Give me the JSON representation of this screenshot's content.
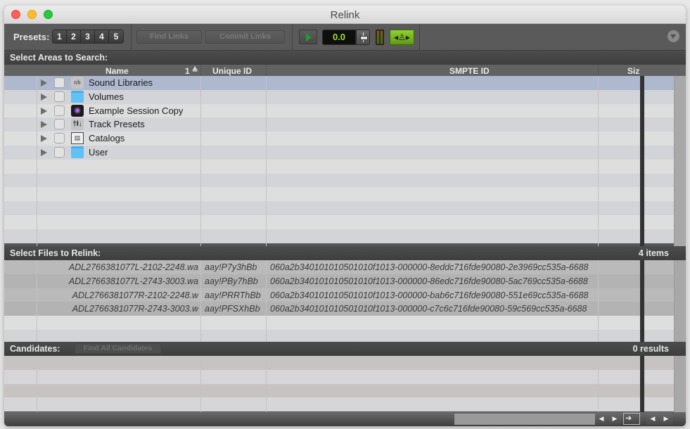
{
  "window": {
    "title": "Relink"
  },
  "toolbar": {
    "presets_label": "Presets:",
    "presets": [
      "1",
      "2",
      "3",
      "4",
      "5"
    ],
    "find_links": "Find Links",
    "commit_links": "Commit Links",
    "counter_value": "0.0",
    "metronome_glyph": "◂♙▸"
  },
  "areas": {
    "title": "Select Areas to Search:",
    "columns": {
      "name": "Name",
      "sort_index": "1",
      "sort_glyph": "≜",
      "unique_id": "Unique ID",
      "smpte_id": "SMPTE ID",
      "size": "Siz"
    },
    "items": [
      {
        "label": "Sound Libraries",
        "icon": "sound-library-icon",
        "glyph": "ıılı",
        "selected": true
      },
      {
        "label": "Volumes",
        "icon": "folder-icon",
        "glyph": "",
        "selected": false
      },
      {
        "label": "Example Session Copy",
        "icon": "session-icon",
        "glyph": "◉",
        "selected": false
      },
      {
        "label": "Track Presets",
        "icon": "track-presets-icon",
        "glyph": "†ł↓",
        "selected": false
      },
      {
        "label": "Catalogs",
        "icon": "catalog-icon",
        "glyph": "▤",
        "selected": false
      },
      {
        "label": "User",
        "icon": "folder-icon",
        "glyph": "",
        "selected": false
      }
    ]
  },
  "files": {
    "title": "Select Files to Relink:",
    "count": "4 items",
    "rows": [
      {
        "name": "ADL2766381077L-2102-2248.wa",
        "unique_id": "aay!P7y3hBb",
        "smpte_id": "060a2b340101010501010f1013-000000-8eddc716fde90080-2e3969cc535a-6688"
      },
      {
        "name": "ADL2766381077L-2743-3003.wa",
        "unique_id": "aay!PBy7hBb",
        "smpte_id": "060a2b340101010501010f1013-000000-86edc716fde90080-5ac769cc535a-6688"
      },
      {
        "name": "ADL2766381077R-2102-2248.w",
        "unique_id": "aay!PRRThBb",
        "smpte_id": "060a2b340101010501010f1013-000000-bab6c716fde90080-551e69cc535a-6688"
      },
      {
        "name": "ADL2766381077R-2743-3003.w",
        "unique_id": "aay!PFSXhBb",
        "smpte_id": "060a2b340101010501010f1013-000000-c7c6c716fde90080-59c569cc535a-6688"
      }
    ]
  },
  "candidates": {
    "title": "Candidates:",
    "find_all": "Find All Candidates",
    "count": "0 results"
  },
  "bottom": {
    "prev": "◀",
    "next": "▶",
    "zoom": "➔"
  },
  "colors": {
    "accent_green": "#8fd12c",
    "counter_text": "#9be22a",
    "selected_row": "#aeb9cf"
  }
}
